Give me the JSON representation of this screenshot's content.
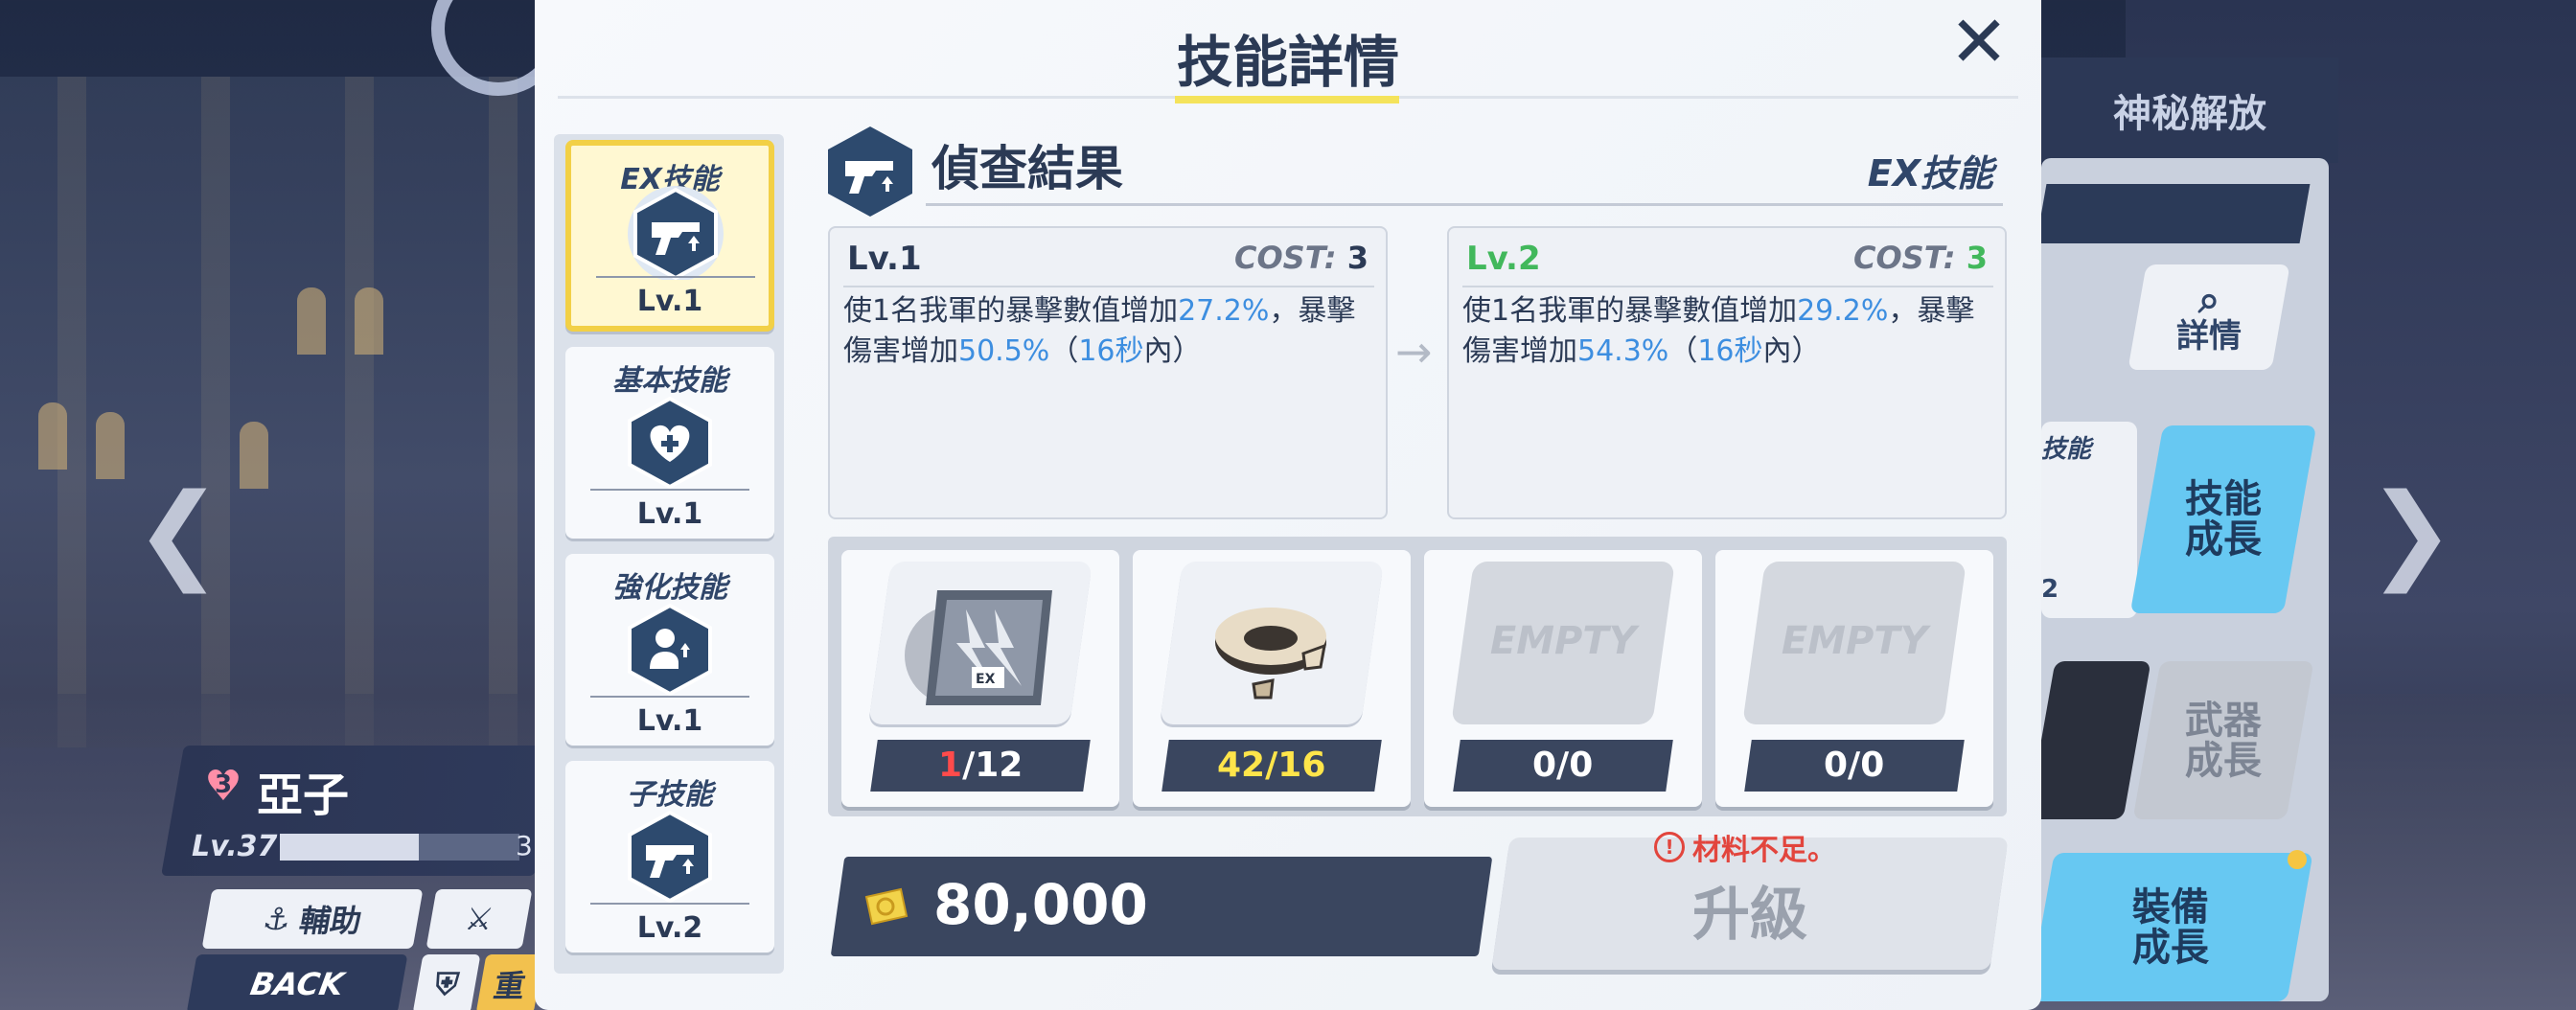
{
  "modal": {
    "title": "技能詳情",
    "close_glyph": "✕"
  },
  "left_skills": [
    {
      "type": "EX技能",
      "level": "Lv.1",
      "icon": "pistol-icon",
      "selected": true
    },
    {
      "type": "基本技能",
      "level": "Lv.1",
      "icon": "heart-heal-icon",
      "selected": false
    },
    {
      "type": "強化技能",
      "level": "Lv.1",
      "icon": "buff-person-icon",
      "selected": false
    },
    {
      "type": "子技能",
      "level": "Lv.2",
      "icon": "pistol-icon",
      "selected": false
    }
  ],
  "skill": {
    "name": "偵查結果",
    "kind": "EX技能"
  },
  "current": {
    "level": "Lv.1",
    "cost_label": "COST:",
    "cost": "3",
    "desc_a": "使1名我軍的暴擊數值增加",
    "val_a": "27.2%",
    "desc_b": "，暴擊傷害增加",
    "val_b": "50.5%",
    "desc_c": "（",
    "val_c": "16秒",
    "desc_d": "內）"
  },
  "next": {
    "level": "Lv.2",
    "cost_label": "COST:",
    "cost": "3",
    "desc_a": "使1名我軍的暴擊數值增加",
    "val_a": "29.2%",
    "desc_b": "，暴擊傷害增加",
    "val_b": "54.3%",
    "desc_c": "（",
    "val_c": "16秒",
    "desc_d": "內）"
  },
  "arrow_glyph": "→",
  "materials": [
    {
      "kind": "ex-disc-item",
      "have": "1",
      "sep": "/",
      "need": "12",
      "status": "insufficient"
    },
    {
      "kind": "ring-artifact-item",
      "have": "42",
      "sep": "/",
      "need": "16",
      "status": "enough"
    },
    {
      "kind": "empty",
      "label": "EMPTY",
      "count": "0/0"
    },
    {
      "kind": "empty",
      "label": "EMPTY",
      "count": "0/0"
    }
  ],
  "cost": {
    "amount": "80,000",
    "icon": "credit-icon"
  },
  "upgrade": {
    "label": "升級",
    "warning": "材料不足。",
    "warning_icon": "!"
  },
  "background": {
    "right_tab": "神秘解放",
    "detail_btn": "詳情",
    "skill_grow_btn": "技能\n成長",
    "weapon_grow_btn": "武器\n成長",
    "gear_grow_btn": "裝備\n成長",
    "small_card_label": "技能",
    "small_card_num": "2",
    "char_name": "亞子",
    "char_heart": "3",
    "char_level": "Lv.37",
    "char_bar_num": "3",
    "role_btn": "輔助",
    "back_btn": "BACK",
    "bottom_partial": "重",
    "nav_left": "❮",
    "nav_right": "❯"
  },
  "colors": {
    "accent_yellow": "#f4e35b",
    "highlight_blue": "#3d8ee0",
    "green": "#42b85c",
    "red": "#ff4b4b"
  }
}
